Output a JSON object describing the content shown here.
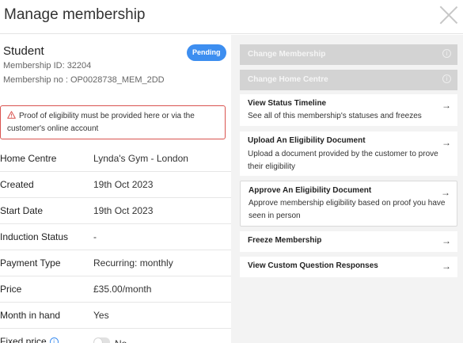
{
  "header": {
    "title": "Manage membership"
  },
  "membership": {
    "name": "Student",
    "badge": "Pending",
    "id_line": "Membership ID: 32204",
    "no_line": "Membership no : OP0028738_MEM_2DD"
  },
  "alert": {
    "text": "Proof of eligibility must be provided here or via the customer's online account"
  },
  "details": [
    {
      "label": "Home Centre",
      "value": "Lynda's Gym - London"
    },
    {
      "label": "Created",
      "value": "19th Oct 2023"
    },
    {
      "label": "Start Date",
      "value": "19th Oct 2023"
    },
    {
      "label": "Induction Status",
      "value": "-"
    },
    {
      "label": "Payment Type",
      "value": "Recurring: monthly"
    },
    {
      "label": "Price",
      "value": "£35.00/month"
    },
    {
      "label": "Month in hand",
      "value": "Yes"
    },
    {
      "label": "Fixed price",
      "value": "No",
      "info_icon": "i"
    }
  ],
  "actions": [
    {
      "title": "Change Membership",
      "info_icon": "i"
    },
    {
      "title": "Change Home Centre",
      "info_icon": "i"
    },
    {
      "title": "View Status Timeline",
      "description": "See all of this membership's statuses and freezes",
      "arrow": "→"
    },
    {
      "title": "Upload An Eligibility Document",
      "description": "Upload a document provided by the customer to prove their eligibility",
      "arrow": "→"
    },
    {
      "title": "Approve An Eligibility Document",
      "description": "Approve membership eligibility based on proof you have seen in person",
      "arrow": "→"
    },
    {
      "title": "Freeze Membership",
      "arrow": "→"
    },
    {
      "title": "View Custom Question Responses",
      "arrow": "→"
    }
  ],
  "colors": {
    "accent": "#3d8ef0",
    "alert_border": "#d9534f",
    "disabled": "#d3d3d3"
  }
}
